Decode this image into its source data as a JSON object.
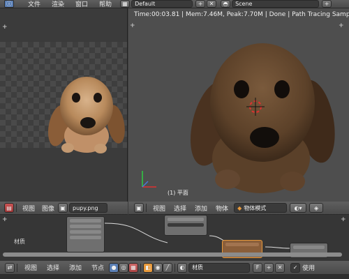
{
  "topbar": {
    "menu_items": [
      "文件",
      "渲染",
      "窗口",
      "帮助"
    ],
    "layout_name": "Default",
    "scene_name": "Scene"
  },
  "viewport3d": {
    "status": "Time:00:03.81 | Mem:7.46M, Peak:7.70M | Done | Path Tracing Sample 32/32",
    "object_label": "(1) 平面",
    "header": {
      "view": "视图",
      "select": "选择",
      "add": "添加",
      "object": "物体",
      "mode": "物体模式"
    }
  },
  "image_editor": {
    "header": {
      "view": "视图",
      "image": "图像",
      "image_name": "pupy.png"
    }
  },
  "node_editor": {
    "panel_label": "材质",
    "header": {
      "view": "视图",
      "select": "选择",
      "add": "添加",
      "node": "节点",
      "material": "材质",
      "fake_user": "F",
      "use_nodes": "使用"
    }
  },
  "colors": {
    "accent_orange": "#e89a3c",
    "cursor_red": "#e03030",
    "axis_green": "#2ecc40",
    "axis_red": "#e03030"
  }
}
